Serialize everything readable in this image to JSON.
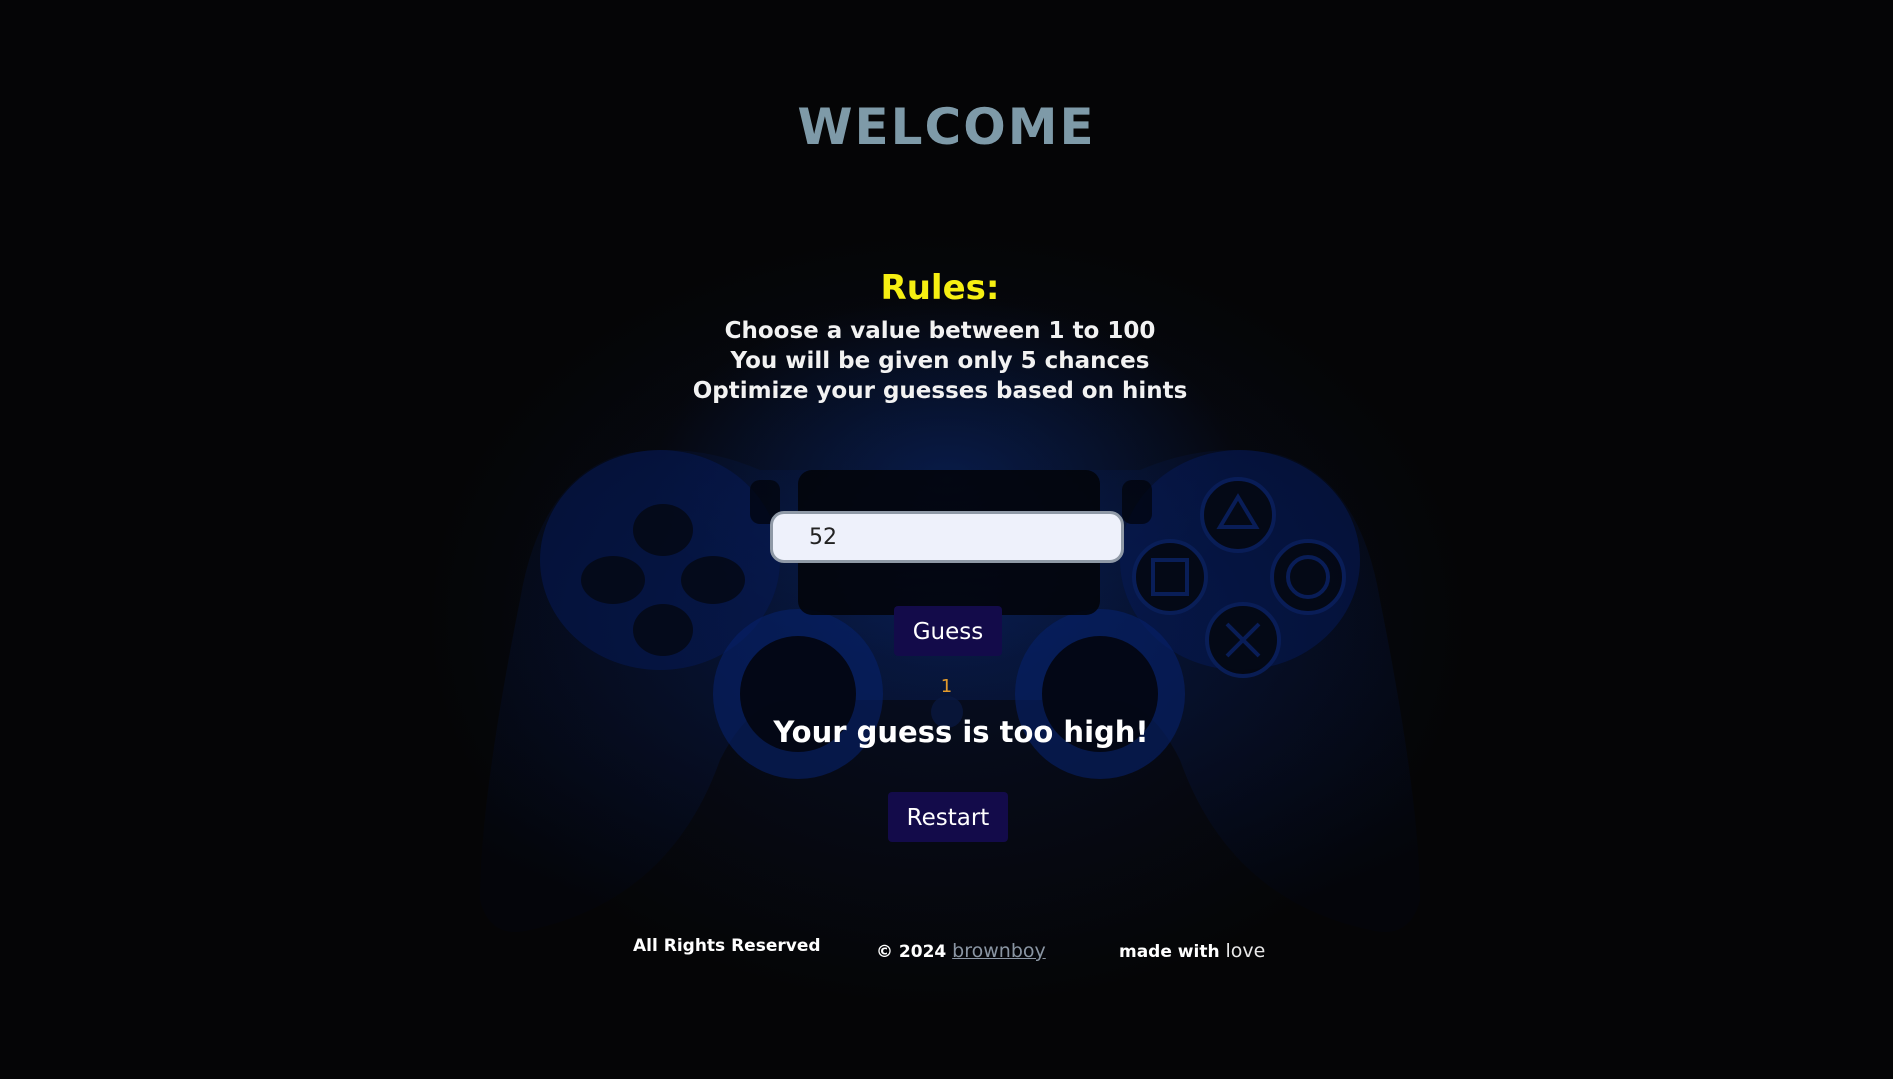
{
  "header": {
    "title": "WELCOME"
  },
  "rules": {
    "heading": "Rules:",
    "lines": [
      "Choose a value between 1 to 100",
      "You will be given only 5 chances",
      "Optimize your guesses based on hints"
    ]
  },
  "game": {
    "guess_value": "52",
    "guess_label": "Guess",
    "attempts": "1",
    "message": "Your guess is too high!",
    "restart_label": "Restart"
  },
  "footer": {
    "rights": "All Rights Reserved",
    "copyright_prefix": "© 2024",
    "author": "brownboy",
    "made_with": "made with",
    "love": "love"
  },
  "colors": {
    "title": "#7e9aa8",
    "rules_heading": "#f6ef12",
    "button_bg": "#130b4a",
    "attempts": "#e39a2c"
  },
  "background_icon": "game-controller-icon"
}
